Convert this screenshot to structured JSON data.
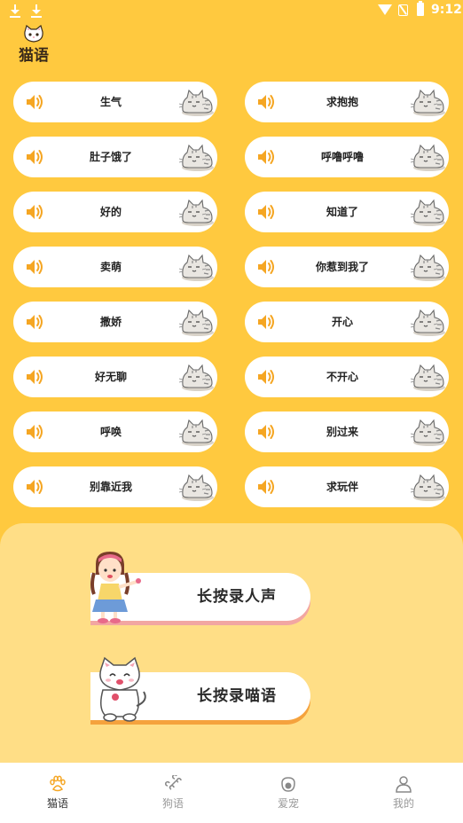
{
  "status_bar": {
    "time": "9:12"
  },
  "app": {
    "logo_text": "猫语"
  },
  "sounds": [
    {
      "label": "生气"
    },
    {
      "label": "求抱抱"
    },
    {
      "label": "肚子饿了"
    },
    {
      "label": "呼噜呼噜"
    },
    {
      "label": "好的"
    },
    {
      "label": "知道了"
    },
    {
      "label": "卖萌"
    },
    {
      "label": "你惹到我了"
    },
    {
      "label": "撒娇"
    },
    {
      "label": "开心"
    },
    {
      "label": "好无聊"
    },
    {
      "label": "不开心"
    },
    {
      "label": "呼唤"
    },
    {
      "label": "别过来"
    },
    {
      "label": "别靠近我"
    },
    {
      "label": "求玩伴"
    }
  ],
  "record": {
    "human_label": "长按录人声",
    "meow_label": "长按录喵语"
  },
  "tabs": [
    {
      "label": "猫语",
      "icon": "paw-icon",
      "active": true
    },
    {
      "label": "狗语",
      "icon": "bone-icon",
      "active": false
    },
    {
      "label": "爱宠",
      "icon": "pet-food-icon",
      "active": false
    },
    {
      "label": "我的",
      "icon": "user-icon",
      "active": false
    }
  ],
  "colors": {
    "background": "#FFC93F",
    "panel": "#FFDE86",
    "speaker": "#F5A623",
    "human_shadow": "#F2A6A2",
    "meow_shadow": "#F5A23D",
    "active_tab_icon": "#F5A623"
  }
}
